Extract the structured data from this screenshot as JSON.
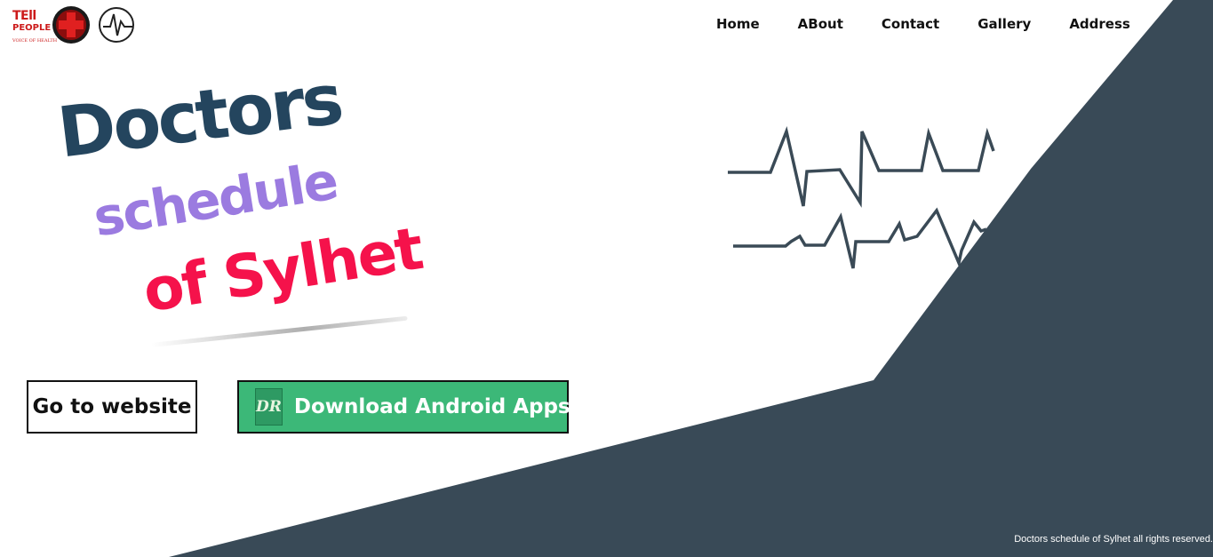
{
  "logo": {
    "line1": "TEll",
    "line2": "PEOPLE",
    "tagline": "VOICE OF HEALTH",
    "icons": [
      "red-cross-icon",
      "heartbeat-icon"
    ]
  },
  "nav": {
    "items": [
      {
        "label": "Home"
      },
      {
        "label": "ABout"
      },
      {
        "label": "Contact"
      },
      {
        "label": "Gallery"
      },
      {
        "label": "Address"
      }
    ]
  },
  "hero": {
    "line1": "Doctors",
    "line2": "schedule",
    "line3": "of Sylhet"
  },
  "buttons": {
    "website": "Go to website",
    "android": "Download Android Apps",
    "android_icon": "DR"
  },
  "footer": {
    "text": "Doctors schedule of Sylhet all rights reserved."
  },
  "colors": {
    "shape": "#394a57",
    "title_dark": "#24455e",
    "title_purple": "#9b7be0",
    "title_red": "#f5124b",
    "android_button": "#3cb878",
    "ekg": "#3a4a56"
  }
}
